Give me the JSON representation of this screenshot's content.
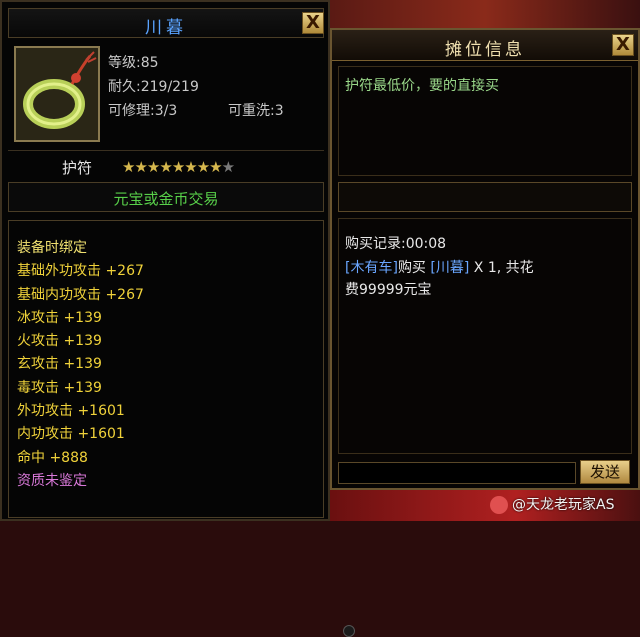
{
  "item": {
    "name": "川暮",
    "close_label": "X",
    "stats": {
      "level": "等级:85",
      "durability": "耐久:219/219",
      "repair": "可修理:3/3",
      "rewash": "可重洗:3"
    },
    "type": "护符",
    "stars_total": 9,
    "stars_filled": 8,
    "trade": "元宝或金币交易",
    "attributes": [
      "装备时绑定",
      "基础外功攻击 +267",
      "基础内功攻击 +267",
      "冰攻击 +139",
      "火攻击 +139",
      "玄攻击 +139",
      "毒攻击 +139",
      "外功攻击 +1601",
      "内功攻击 +1601",
      "命中 +888",
      "资质未鉴定"
    ]
  },
  "stall": {
    "title": "摊位信息",
    "close_label": "X",
    "message": "护符最低价，要的直接买",
    "record_heading": "购买记录:00:08",
    "record": {
      "buyer": "[木有车]",
      "action": "购买",
      "item": "[川暮]",
      "detail": " X 1, 共花",
      "cost": "费99999元宝"
    },
    "send_label": "发送"
  },
  "watermark": "@天龙老玩家AS",
  "colors": {
    "accent_gold": "#d6b84e",
    "title_blue": "#5aa3ff",
    "attr_yellow": "#f0d23a",
    "trade_green": "#58d04a"
  }
}
